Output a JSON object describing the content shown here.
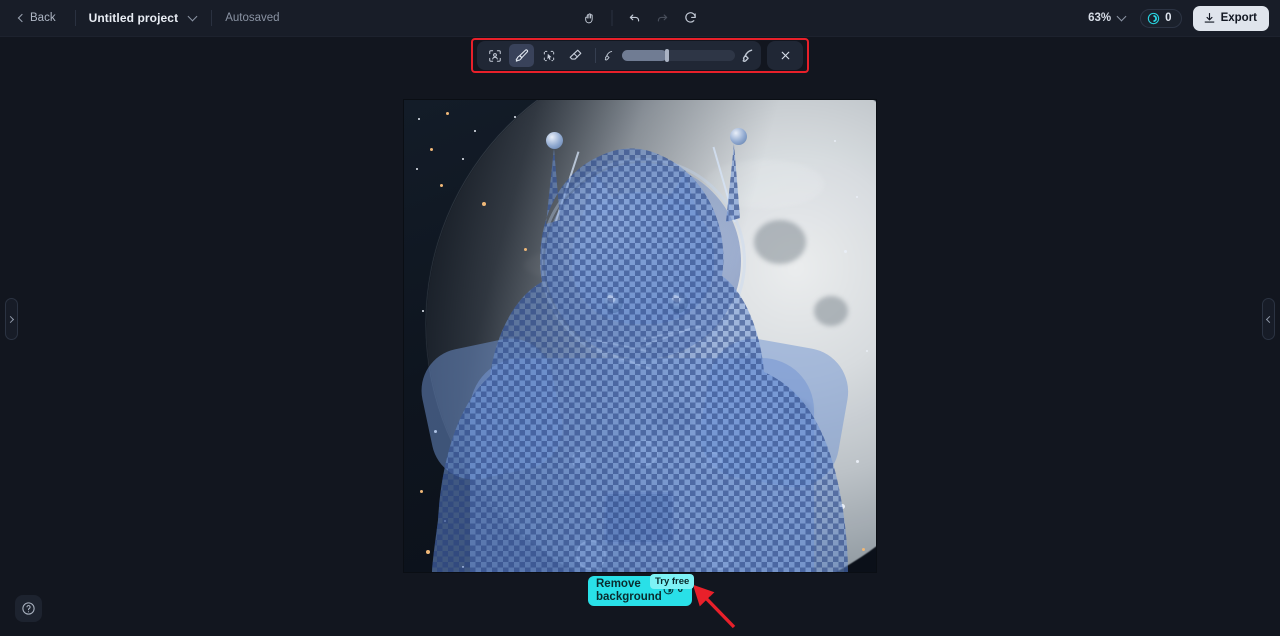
{
  "app": {
    "background": "#12161f",
    "accent_cyan": "#29e0e8",
    "annotation_red": "#e8202a"
  },
  "topbar": {
    "back_label": "Back",
    "project_name": "Untitled project",
    "project_menu_icon": "chevron-down-icon",
    "save_status": "Autosaved",
    "center_tools": [
      {
        "name": "pan-hand-icon",
        "label": "Pan",
        "state": "enabled"
      },
      {
        "name": "undo-icon",
        "label": "Undo",
        "state": "enabled"
      },
      {
        "name": "redo-icon",
        "label": "Redo",
        "state": "disabled"
      },
      {
        "name": "reset-icon",
        "label": "Reset",
        "state": "enabled"
      }
    ],
    "zoom_level": "63%",
    "zoom_menu_icon": "chevron-down-icon",
    "credits_icon": "credit-coin-icon",
    "credits_value": "0",
    "export_label": "Export",
    "export_icon": "download-icon"
  },
  "edit_toolbar": {
    "highlighted": true,
    "tools": [
      {
        "name": "auto-select-subject-icon",
        "label": "Select subject",
        "active": false
      },
      {
        "name": "brush-icon",
        "label": "Brush",
        "active": true
      },
      {
        "name": "magic-select-icon",
        "label": "Magic select",
        "active": false
      },
      {
        "name": "eraser-icon",
        "label": "Eraser",
        "active": false
      }
    ],
    "brush_size": {
      "small_icon": "brush-small-icon",
      "large_icon": "brush-large-icon",
      "value_percent": 40
    },
    "close_label": "Close",
    "close_icon": "close-icon"
  },
  "canvas": {
    "artboard_label": "astronaut-cat-artboard",
    "zoom": "63%",
    "selection_overlay": "transparency-checkerboard",
    "scene": {
      "background": "starfield-space",
      "moon": "full-moon-with-craters",
      "subject": "cat-astronaut-in-spacesuit",
      "limb_glow_color": "#ffaa42"
    }
  },
  "panels": {
    "left_handle_icon": "chevron-right-icon",
    "left_handle_label": "Expand left panel",
    "right_handle_icon": "chevron-left-icon",
    "right_handle_label": "Expand right panel"
  },
  "help": {
    "icon": "question-mark-icon",
    "label": "Help"
  },
  "remove_background": {
    "label": "Remove background",
    "credit_icon": "credit-coin-icon",
    "credit_cost": "0",
    "badge_label": "Try free"
  },
  "annotation": {
    "arrow": "red-arrow-pointing-to-remove-background",
    "color": "#e8202a"
  }
}
